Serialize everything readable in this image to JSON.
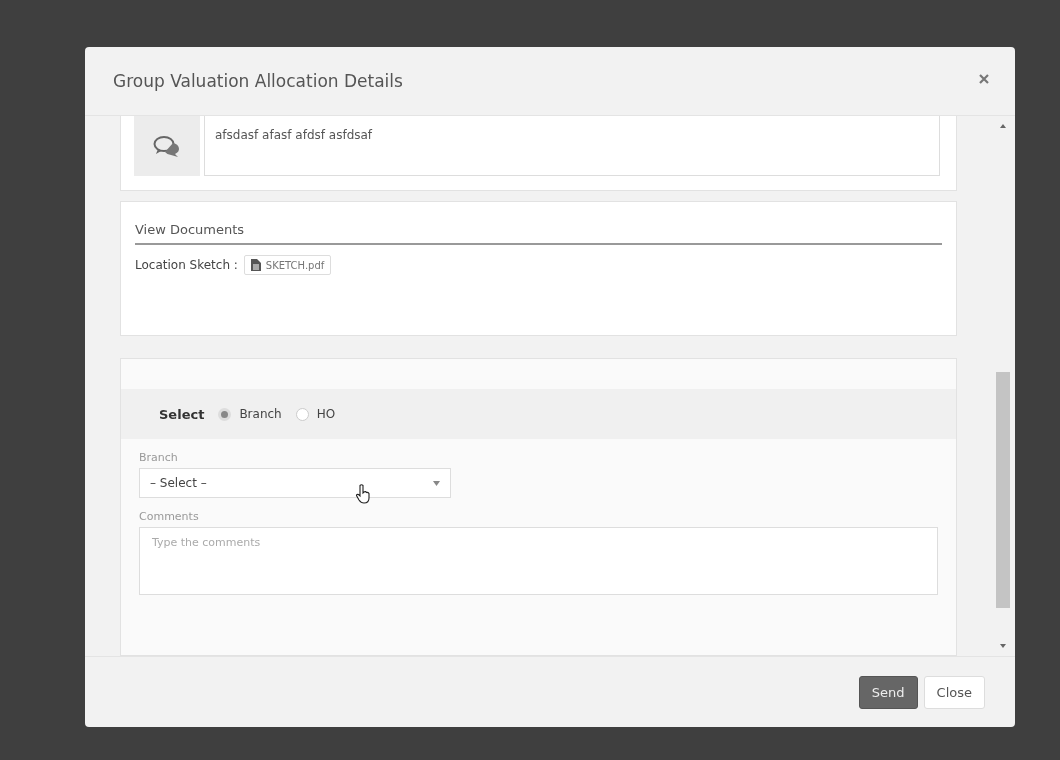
{
  "dialog": {
    "title": "Group Valuation Allocation Details"
  },
  "message": {
    "text": "afsdasf afasf afdsf asfdsaf"
  },
  "documents": {
    "heading": "View Documents",
    "items": [
      {
        "label": "Location Sketch :",
        "file": "SKETCH.pdf"
      }
    ]
  },
  "form": {
    "select_label": "Select",
    "options": [
      {
        "label": "Branch",
        "selected": true
      },
      {
        "label": "HO",
        "selected": false
      }
    ],
    "branch": {
      "label": "Branch",
      "value": "– Select –"
    },
    "comments": {
      "label": "Comments",
      "placeholder": "Type the comments"
    }
  },
  "buttons": [
    {
      "label": "Send",
      "kind": "primary"
    },
    {
      "label": "Close",
      "kind": "default"
    }
  ]
}
